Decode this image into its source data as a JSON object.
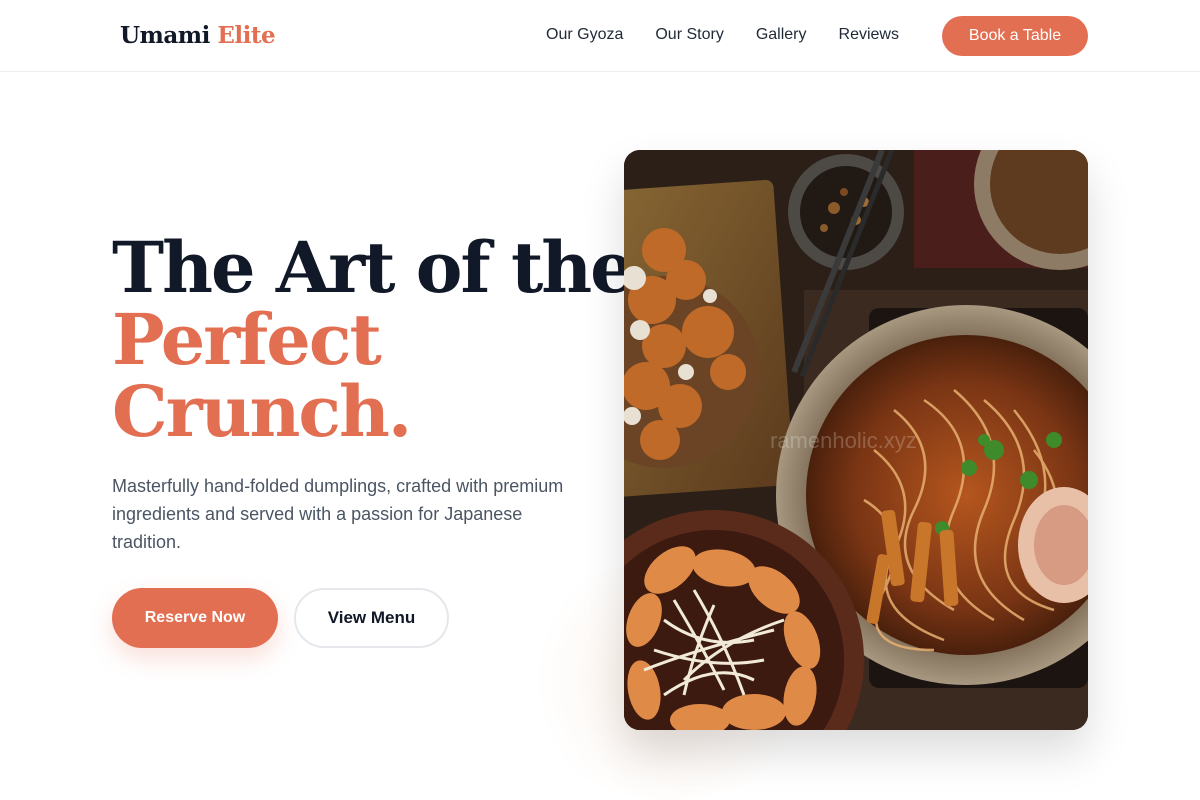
{
  "brand": {
    "name_part1": "Umami",
    "name_part2": "Elite"
  },
  "nav": {
    "links": [
      "Our Gyoza",
      "Our Story",
      "Gallery",
      "Reviews"
    ],
    "cta_label": "Book a Table"
  },
  "hero": {
    "headline_line1": "The Art of the",
    "headline_line2": "Perfect",
    "headline_line3": "Crunch.",
    "description": "Masterfully hand-folded dumplings, crafted with premium ingredients and served with a passion for Japanese tradition.",
    "primary_button": "Reserve Now",
    "secondary_button": "View Menu",
    "image_watermark": "ramenholic.xyz"
  },
  "colors": {
    "accent": "#e36f52",
    "text_dark": "#111827",
    "text_muted": "#4b5563"
  }
}
